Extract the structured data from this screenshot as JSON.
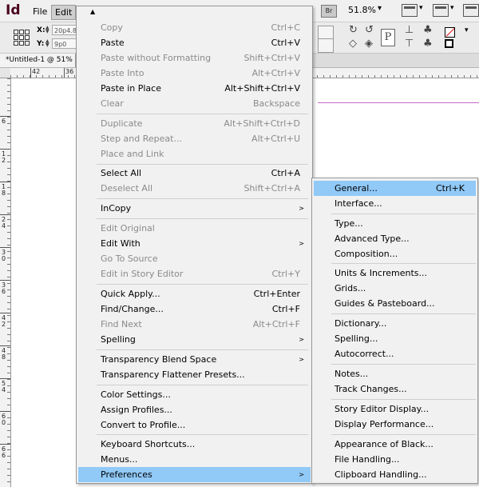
{
  "app": {
    "logo": "Id",
    "menus": [
      "File",
      "Edit"
    ],
    "bridge_badge": "Br",
    "zoom": "51.8%",
    "zoom_arrow": "▾"
  },
  "control_panel": {
    "x_label": "X:",
    "x_value": "20p4.8",
    "y_label": "Y:",
    "y_value": "9p0",
    "p_glyph": "P"
  },
  "document": {
    "tab_title": "*Untitled-1 @ 51%",
    "ruler_top": [
      "42",
      "36"
    ],
    "ruler_left": [
      "6",
      "1 2",
      "1 8",
      "2 4",
      "3 0",
      "3 6",
      "4 2",
      "4 8",
      "5 4",
      "6 0",
      "6 6"
    ]
  },
  "edit_menu": {
    "scroll_glyph": "▲",
    "items": [
      {
        "label": "Copy",
        "shortcut": "Ctrl+C",
        "disabled": true
      },
      {
        "label": "Paste",
        "shortcut": "Ctrl+V",
        "disabled": false
      },
      {
        "label": "Paste without Formatting",
        "shortcut": "Shift+Ctrl+V",
        "disabled": true
      },
      {
        "label": "Paste Into",
        "shortcut": "Alt+Ctrl+V",
        "disabled": true
      },
      {
        "label": "Paste in Place",
        "shortcut": "Alt+Shift+Ctrl+V",
        "disabled": false
      },
      {
        "label": "Clear",
        "shortcut": "Backspace",
        "disabled": true
      },
      {
        "label": "Duplicate",
        "shortcut": "Alt+Shift+Ctrl+D",
        "disabled": true
      },
      {
        "label": "Step and Repeat...",
        "shortcut": "Alt+Ctrl+U",
        "disabled": true
      },
      {
        "label": "Place and Link",
        "shortcut": "",
        "disabled": true
      },
      {
        "label": "Select All",
        "shortcut": "Ctrl+A",
        "disabled": false
      },
      {
        "label": "Deselect All",
        "shortcut": "Shift+Ctrl+A",
        "disabled": true
      },
      {
        "label": "InCopy",
        "shortcut": "",
        "disabled": false,
        "submenu": true
      },
      {
        "label": "Edit Original",
        "shortcut": "",
        "disabled": true
      },
      {
        "label": "Edit With",
        "shortcut": "",
        "disabled": false,
        "submenu": true
      },
      {
        "label": "Go To Source",
        "shortcut": "",
        "disabled": true
      },
      {
        "label": "Edit in Story Editor",
        "shortcut": "Ctrl+Y",
        "disabled": true
      },
      {
        "label": "Quick Apply...",
        "shortcut": "Ctrl+Enter",
        "disabled": false
      },
      {
        "label": "Find/Change...",
        "shortcut": "Ctrl+F",
        "disabled": false
      },
      {
        "label": "Find Next",
        "shortcut": "Alt+Ctrl+F",
        "disabled": true
      },
      {
        "label": "Spelling",
        "shortcut": "",
        "disabled": false,
        "submenu": true
      },
      {
        "label": "Transparency Blend Space",
        "shortcut": "",
        "disabled": false,
        "submenu": true
      },
      {
        "label": "Transparency Flattener Presets...",
        "shortcut": "",
        "disabled": false
      },
      {
        "label": "Color Settings...",
        "shortcut": "",
        "disabled": false
      },
      {
        "label": "Assign Profiles...",
        "shortcut": "",
        "disabled": false
      },
      {
        "label": "Convert to Profile...",
        "shortcut": "",
        "disabled": false
      },
      {
        "label": "Keyboard Shortcuts...",
        "shortcut": "",
        "disabled": false
      },
      {
        "label": "Menus...",
        "shortcut": "",
        "disabled": false
      },
      {
        "label": "Preferences",
        "shortcut": "",
        "disabled": false,
        "submenu": true,
        "highlighted": true
      }
    ]
  },
  "preferences_menu": {
    "items": [
      {
        "label": "General...",
        "shortcut": "Ctrl+K",
        "highlighted": true
      },
      {
        "label": "Interface...",
        "shortcut": ""
      },
      {
        "label": "Type...",
        "shortcut": ""
      },
      {
        "label": "Advanced Type...",
        "shortcut": ""
      },
      {
        "label": "Composition...",
        "shortcut": ""
      },
      {
        "label": "Units & Increments...",
        "shortcut": ""
      },
      {
        "label": "Grids...",
        "shortcut": ""
      },
      {
        "label": "Guides & Pasteboard...",
        "shortcut": ""
      },
      {
        "label": "Dictionary...",
        "shortcut": ""
      },
      {
        "label": "Spelling...",
        "shortcut": ""
      },
      {
        "label": "Autocorrect...",
        "shortcut": ""
      },
      {
        "label": "Notes...",
        "shortcut": ""
      },
      {
        "label": "Track Changes...",
        "shortcut": ""
      },
      {
        "label": "Story Editor Display...",
        "shortcut": ""
      },
      {
        "label": "Display Performance...",
        "shortcut": ""
      },
      {
        "label": "Appearance of Black...",
        "shortcut": ""
      },
      {
        "label": "File Handling...",
        "shortcut": ""
      },
      {
        "label": "Clipboard Handling...",
        "shortcut": ""
      }
    ]
  },
  "colors": {
    "highlight": "#91c9f7",
    "disabled_text": "#8a8a8a",
    "logo": "#49021f",
    "guide": "#c86bc8"
  }
}
